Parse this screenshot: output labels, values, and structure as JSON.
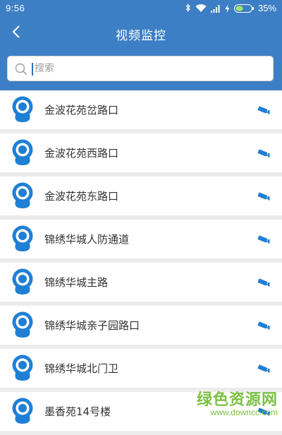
{
  "status_bar": {
    "time": "9:56",
    "battery": "35%"
  },
  "header": {
    "title": "视频监控"
  },
  "search": {
    "placeholder": "搜索",
    "value": ""
  },
  "cameras": [
    {
      "label": "金波花苑岔路口"
    },
    {
      "label": "金波花苑西路口"
    },
    {
      "label": "金波花苑东路口"
    },
    {
      "label": "锦绣华城人防通道"
    },
    {
      "label": "锦绣华城主路"
    },
    {
      "label": "锦绣华城亲子园路口"
    },
    {
      "label": "锦绣华城北门卫"
    },
    {
      "label": "墨香苑14号楼"
    }
  ],
  "watermark": {
    "title": "绿色资源网",
    "url": "www.downcc.com"
  },
  "colors": {
    "header": "#3d7fc4",
    "icon_blue": "#1f7fd4",
    "list_bg": "#ffffff",
    "divider": "#ececec",
    "watermark": "#7bc142"
  },
  "icons": {
    "back": "chevron-left-icon",
    "search": "search-icon",
    "item": "camera-icon",
    "action": "cctv-camera-icon"
  }
}
